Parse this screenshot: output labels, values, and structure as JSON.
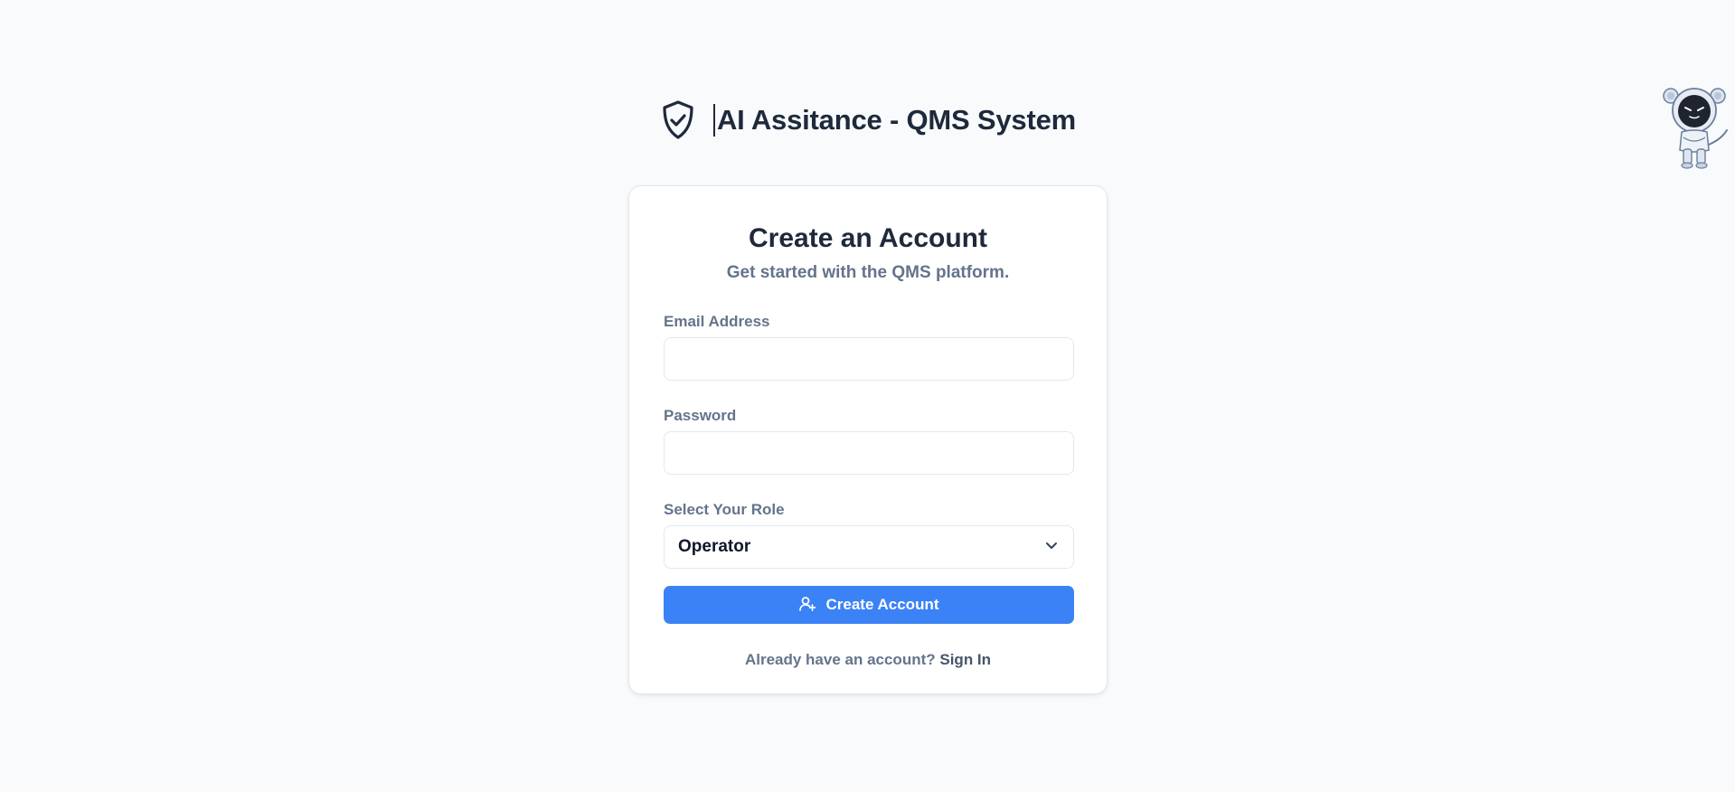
{
  "app": {
    "title": "AI Assitance - QMS System",
    "icon": "shield-check-icon"
  },
  "card": {
    "title": "Create an Account",
    "subtitle": "Get started with the QMS platform."
  },
  "form": {
    "email": {
      "label": "Email Address",
      "value": "",
      "placeholder": ""
    },
    "password": {
      "label": "Password",
      "value": "",
      "placeholder": ""
    },
    "role": {
      "label": "Select Your Role",
      "selected": "Operator",
      "icon": "chevron-down-icon"
    },
    "submit": {
      "label": "Create Account",
      "icon": "user-plus-icon"
    }
  },
  "footer": {
    "prompt": "Already have an account?",
    "link": "Sign In"
  },
  "mascot": {
    "icon": "astronaut-cat-mascot"
  },
  "colors": {
    "background": "#f8fafc",
    "primary": "#3b82f6",
    "text_dark": "#1e293b",
    "text_muted": "#64748b",
    "border": "#e2e8f0"
  }
}
